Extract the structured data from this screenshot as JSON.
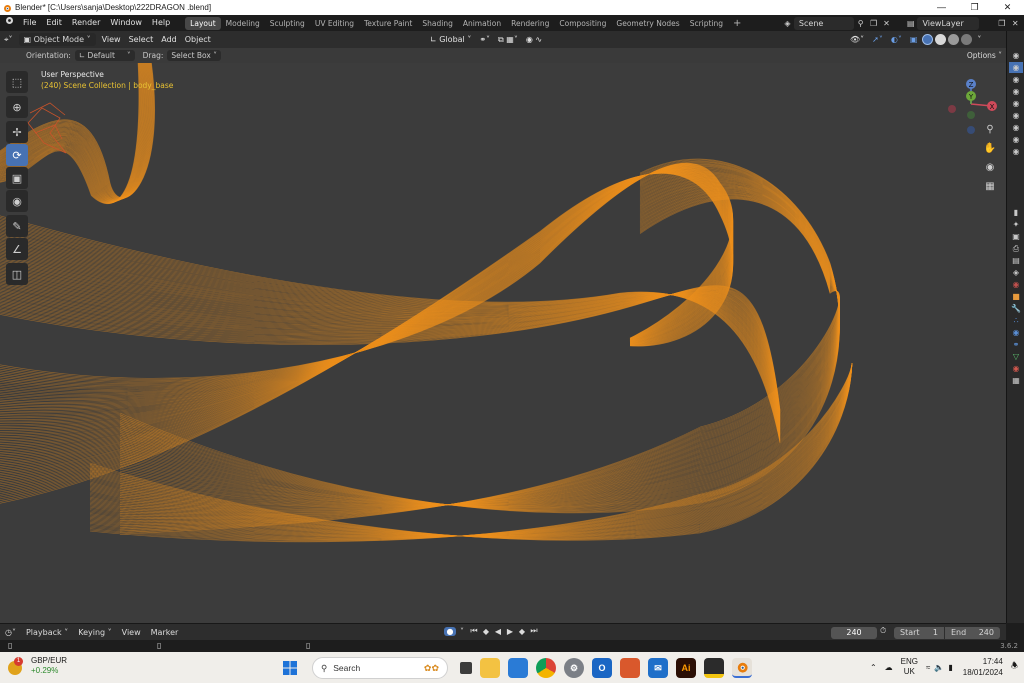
{
  "window": {
    "title": "Blender* [C:\\Users\\sanja\\Desktop\\222DRAGON .blend]",
    "controls": [
      "minimize",
      "maximize",
      "close"
    ]
  },
  "menubar": {
    "items": [
      "File",
      "Edit",
      "Render",
      "Window",
      "Help"
    ],
    "workspaces": [
      "Layout",
      "Modeling",
      "Sculpting",
      "UV Editing",
      "Texture Paint",
      "Shading",
      "Animation",
      "Rendering",
      "Compositing",
      "Geometry Nodes",
      "Scripting"
    ],
    "active_workspace": "Layout",
    "add_tab": "+",
    "scene": "Scene",
    "view_layer": "ViewLayer"
  },
  "header": {
    "mode": "Object Mode",
    "menus": [
      "View",
      "Select",
      "Add",
      "Object"
    ],
    "transform_orientation": "Global"
  },
  "tool_settings": {
    "orientation_label": "Orientation:",
    "orientation_value": "Default",
    "drag_label": "Drag:",
    "drag_value": "Select Box",
    "options": "Options"
  },
  "viewport": {
    "perspective": "User Perspective",
    "collection_info": "(240) Scene Collection | body_base",
    "wire_color": "#f0921e",
    "background": "#3c3c3c",
    "gizmo": {
      "z": "Z",
      "y": "Y",
      "x": "X"
    }
  },
  "tools": [
    "select-box",
    "cursor",
    "move",
    "rotate",
    "scale",
    "transform",
    "annotate",
    "measure",
    "add-cube"
  ],
  "timeline": {
    "menus": [
      "Playback",
      "Keying",
      "View",
      "Marker"
    ],
    "current_frame": "240",
    "start_label": "Start",
    "start_value": "1",
    "end_label": "End",
    "end_value": "240"
  },
  "status": {
    "version": "3.6.2"
  },
  "taskbar": {
    "widget_title": "GBP/EUR",
    "widget_change": "+0.29%",
    "widget_badge": "1",
    "search_placeholder": "Search",
    "lang_top": "ENG",
    "lang_bottom": "UK",
    "time": "17:44",
    "date": "18/01/2024"
  }
}
